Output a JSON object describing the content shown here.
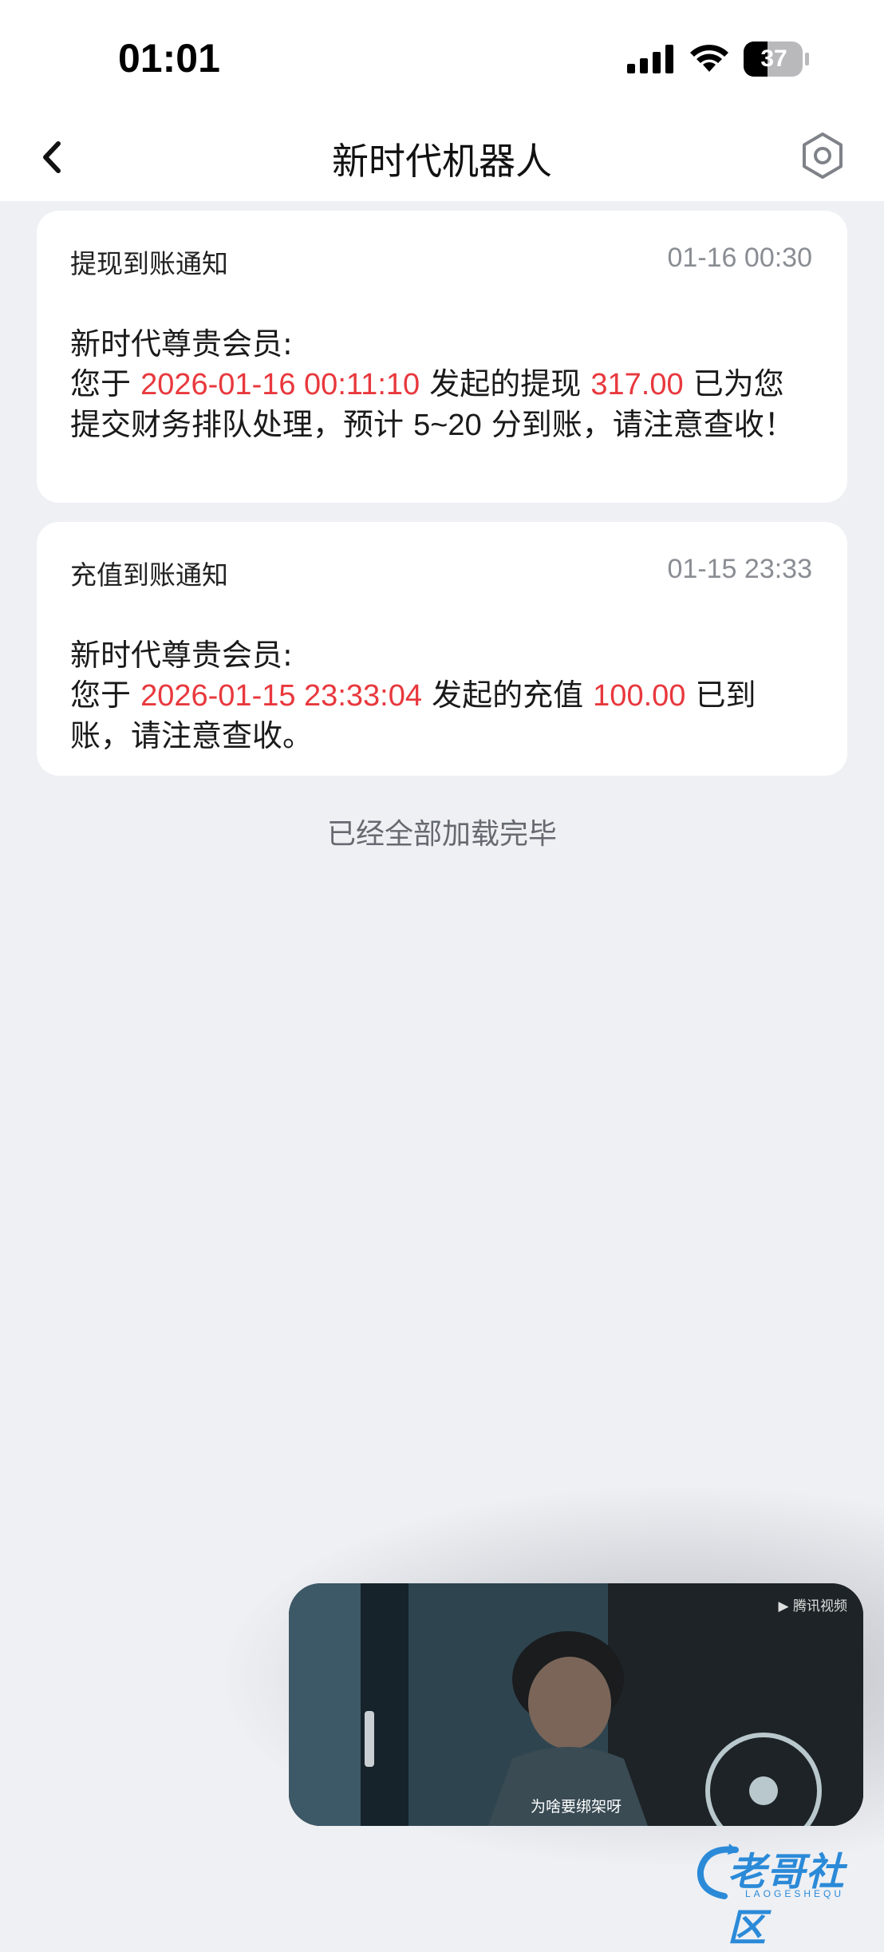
{
  "status_bar": {
    "time": "01:01",
    "battery": "37",
    "icons": [
      "cellular-signal-icon",
      "wifi-icon",
      "battery-icon"
    ]
  },
  "nav": {
    "title": "新时代机器人",
    "back_icon": "chevron-left-icon",
    "settings_icon": "gear-icon"
  },
  "messages": [
    {
      "title": "提现到账通知",
      "time": "01-16 00:30",
      "greeting": "新时代尊贵会员:",
      "prefix": "您于",
      "datetime": "2026-01-16 00:11:10",
      "action": "发起的提现",
      "amount": "317.00",
      "suffix": "已为您提交财务排队处理，预计",
      "eta": "5~20",
      "tail": "分到账，请注意查收！"
    },
    {
      "title": "充值到账通知",
      "time": "01-15 23:33",
      "greeting": "新时代尊贵会员:",
      "prefix": "您于",
      "datetime": "2026-01-15 23:33:04",
      "action": "发起的充值",
      "amount": "100.00",
      "suffix": "已到账，请注意查收。"
    }
  ],
  "footer": {
    "load_complete": "已经全部加载完毕"
  },
  "video": {
    "brand": "▶ 腾讯视频",
    "subtitle": "为啥要绑架呀"
  },
  "watermark": {
    "text": "老哥社区",
    "sub": "LAOGESHEQU"
  },
  "colors": {
    "accent_red": "#e8383d",
    "background": "#eef0f4",
    "card": "#ffffff",
    "watermark_blue": "#2b8ad8"
  }
}
